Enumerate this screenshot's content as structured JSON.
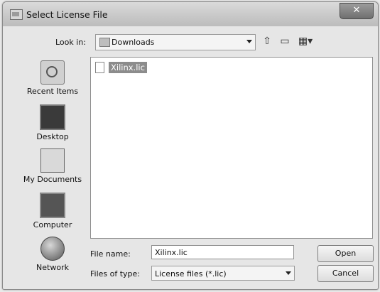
{
  "dialog": {
    "title": "Select License File",
    "close_glyph": "✕"
  },
  "look_in": {
    "label": "Look in:",
    "value": "Downloads"
  },
  "toolbar": {
    "up_icon": "up-one-level-icon",
    "new_folder_icon": "new-folder-icon",
    "views_icon": "views-menu-icon"
  },
  "places": [
    {
      "label": "Recent Items",
      "icon": "recent-items-icon"
    },
    {
      "label": "Desktop",
      "icon": "desktop-icon"
    },
    {
      "label": "My Documents",
      "icon": "documents-icon"
    },
    {
      "label": "Computer",
      "icon": "computer-icon"
    },
    {
      "label": "Network",
      "icon": "network-icon"
    }
  ],
  "files": [
    {
      "name": "Xilinx.lic",
      "selected": true
    }
  ],
  "file_name": {
    "label": "File name:",
    "value": "Xilinx.lic"
  },
  "file_type": {
    "label": "Files of type:",
    "value": "License files (*.lic)"
  },
  "buttons": {
    "open": "Open",
    "cancel": "Cancel"
  }
}
